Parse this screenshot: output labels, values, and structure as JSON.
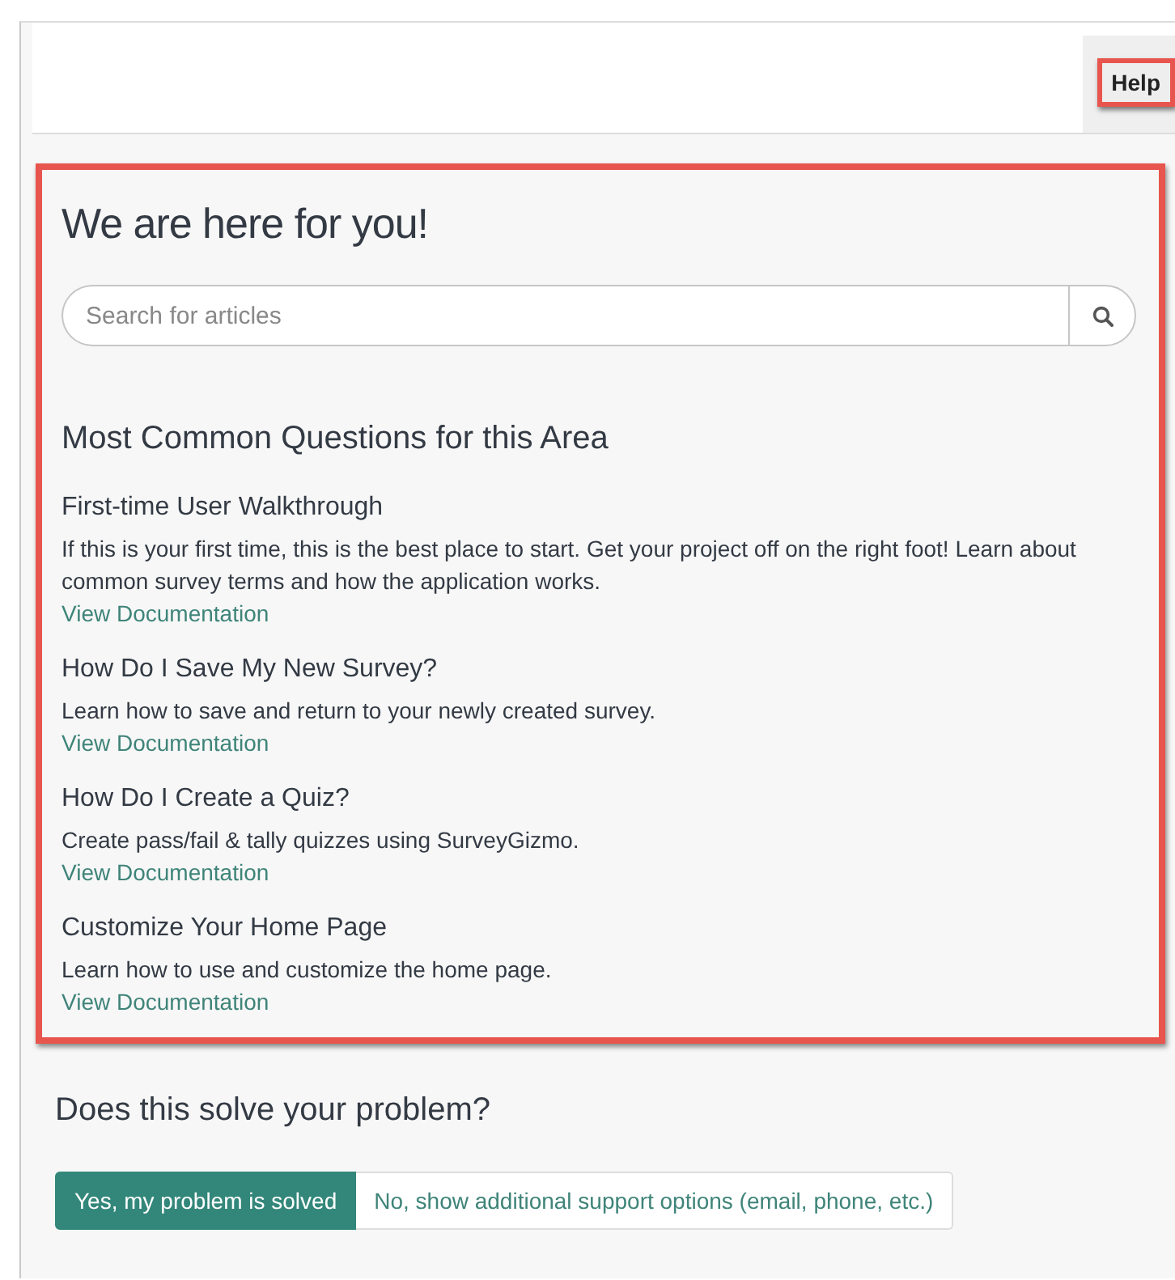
{
  "header": {
    "tab": {
      "label": "Help",
      "highlighted": true
    }
  },
  "panel": {
    "highlighted": true,
    "title": "We are here for you!",
    "search": {
      "placeholder": "Search for articles"
    },
    "section_title": "Most Common Questions for this Area",
    "articles": [
      {
        "title": "First-time User Walkthrough",
        "description": "If this is your first time, this is the best place to start. Get your project off on the right foot! Learn about common survey terms and how the application works.",
        "link": "View Documentation"
      },
      {
        "title": "How Do I Save My New Survey?",
        "description": "Learn how to save and return to your newly created survey.",
        "link": "View Documentation"
      },
      {
        "title": "How Do I Create a Quiz?",
        "description": "Create pass/fail & tally quizzes using SurveyGizmo.",
        "link": "View Documentation"
      },
      {
        "title": "Customize Your Home Page",
        "description": "Learn how to use and customize the home page.",
        "link": "View Documentation"
      }
    ]
  },
  "feedback": {
    "question": "Does this solve your problem?",
    "options": [
      {
        "label": "Yes, my problem is solved",
        "selected": true
      },
      {
        "label": "No, show additional support options (email, phone, etc.)",
        "selected": false
      }
    ]
  }
}
